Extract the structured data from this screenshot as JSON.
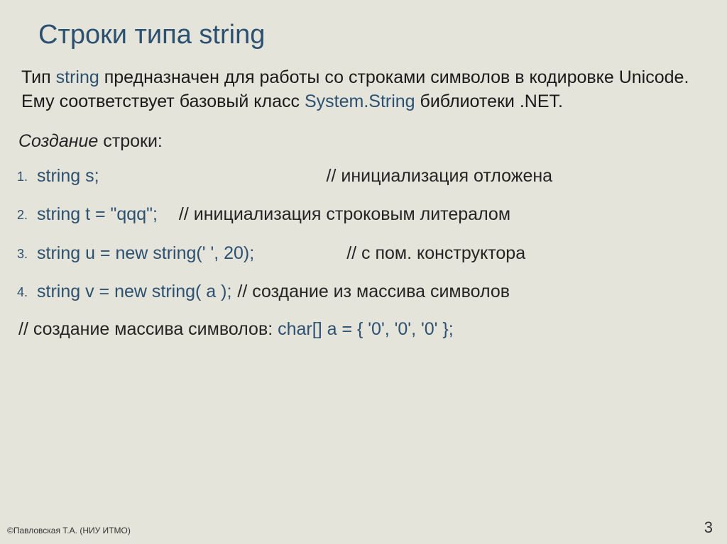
{
  "title": "Строки типа string",
  "intro": {
    "part1": "Тип ",
    "kw1": "string",
    "part2": " предназначен для работы со строками символов в кодировке Unicode. Ему соответствует базовый класс ",
    "kw2": "System.String",
    "part3": " библиотеки .NET."
  },
  "subHeader": {
    "italic": "Создание",
    "plain": " строки:"
  },
  "items": [
    {
      "code": "string s;",
      "comment": "// инициализация отложена",
      "gapStyle": "wideGap"
    },
    {
      "code": "string t = \"qqq\";",
      "comment": "// инициализация строковым литералом",
      "gapStyle": "medGap"
    },
    {
      "code": "string u = new string(' ', 20);",
      "comment": "// с пом. конструктора",
      "gapStyle": "bigGap"
    },
    {
      "code": "string v = new string( a );",
      "comment": "// создание из массива символов",
      "gapStyle": "smallGap"
    }
  ],
  "afterList": {
    "prefix": "// создание массива символов:  ",
    "code": "char[] a = { '0', '0', '0' };"
  },
  "footer": {
    "left": "©Павловская Т.А. (НИУ ИТМО)",
    "right": "3"
  }
}
